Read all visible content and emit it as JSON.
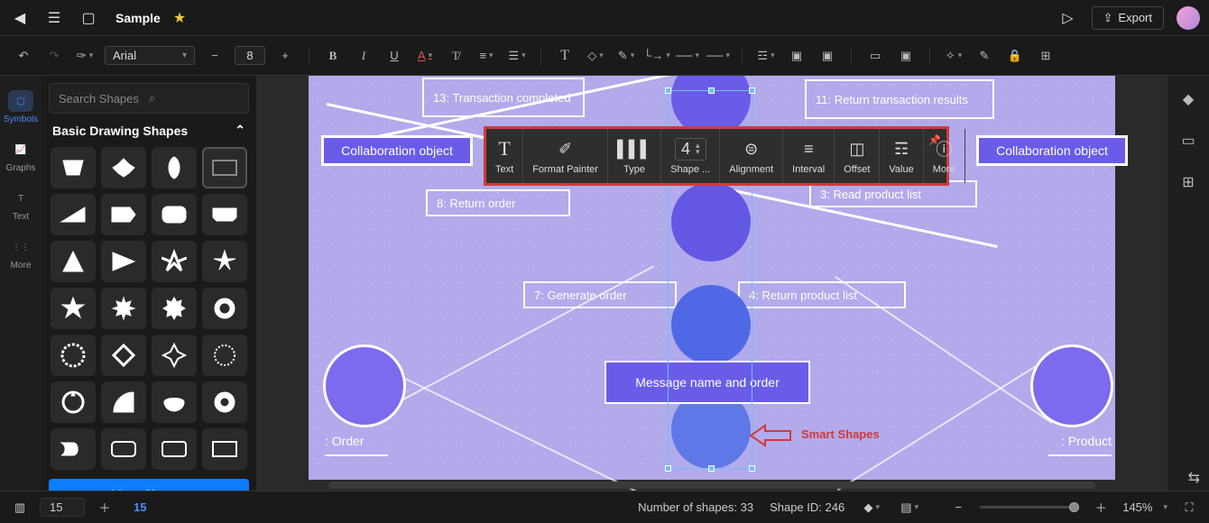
{
  "header": {
    "doc_title": "Sample",
    "export_label": "Export"
  },
  "toolbar": {
    "font_name": "Arial",
    "font_size": "8"
  },
  "rail": {
    "symbols": "Symbols",
    "graphs": "Graphs",
    "text": "Text",
    "more": "More"
  },
  "shapes_panel": {
    "search_placeholder": "Search Shapes",
    "section_title": "Basic Drawing Shapes",
    "more_shapes": "More Shapes"
  },
  "float_panel": {
    "text": "Text",
    "format_painter": "Format Painter",
    "type": "Type",
    "shape": "Shape ...",
    "shape_value": "4",
    "alignment": "Alignment",
    "interval": "Interval",
    "offset": "Offset",
    "value": "Value",
    "more": "More"
  },
  "canvas_nodes": {
    "n13": "13: Transaction completed",
    "n11": "11: Return transaction results",
    "collab_left": "Collaboration object",
    "collab_right": "Collaboration object",
    "n8": "8: Return order",
    "n3": "3: Read product list",
    "n7": "7: Generate order",
    "n4": "4: Return product list",
    "msg": "Message name and order",
    "actor_order": ": Order",
    "actor_product": ": Product",
    "smart_shapes": "Smart Shapes"
  },
  "status": {
    "page_list_value": "15",
    "current_page": "15",
    "num_shapes_label": "Number of shapes:",
    "num_shapes_value": "33",
    "shape_id_label": "Shape ID:",
    "shape_id_value": "246",
    "zoom_label": "145%"
  }
}
